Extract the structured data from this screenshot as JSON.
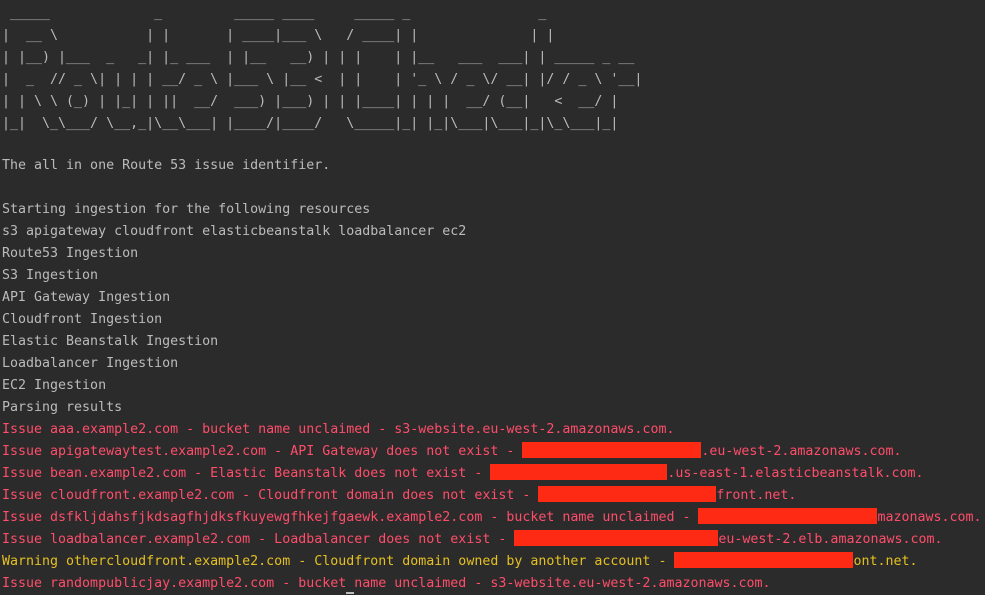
{
  "banner": {
    "ascii_art": " _____             _         _____ ____     _____ _                _\n|  __ \\           | |       | ____|___ \\   / ____| |              | |\n| |__) |___  _   _| |_ ___  | |__   __) | | |    | |__   ___  ___| | _____ _ __\n|  _  // _ \\| | | | __/ _ \\ |___ \\ |__ <  | |    | '_ \\ / _ \\/ __| |/ / _ \\ '__|\n| | \\ \\ (_) | |_| | ||  __/  ___) |___) | | |____| | | |  __/ (__|   <  __/ |\n|_|  \\_\\___/ \\__,_|\\__\\___| |____/|____/   \\_____|_| |_|\\___|\\___|_|\\_\\___|_|"
  },
  "tagline": "The all in one Route 53 issue identifier.",
  "ingestion": {
    "header": "Starting ingestion for the following resources",
    "resources": "s3 apigateway cloudfront elasticbeanstalk loadbalancer ec2",
    "steps": [
      "Route53 Ingestion",
      "S3 Ingestion",
      "API Gateway Ingestion",
      "Cloudfront Ingestion",
      "Elastic Beanstalk Ingestion",
      "Loadbalancer Ingestion",
      "EC2 Ingestion",
      "Parsing results"
    ]
  },
  "results": [
    {
      "text": "Issue aaa.example2.com - bucket name unclaimed - s3-website.eu-west-2.amazonaws.com."
    },
    {
      "prefix": "Issue apigatewaytest.example2.com - API Gateway does not exist - ",
      "suffix": ".eu-west-2.amazonaws.com."
    },
    {
      "prefix": "Issue bean.example2.com - Elastic Beanstalk does not exist - ",
      "suffix": ".us-east-1.elasticbeanstalk.com."
    },
    {
      "prefix": "Issue cloudfront.example2.com - Cloudfront domain does not exist - ",
      "suffix": "front.net."
    },
    {
      "prefix": "Issue dsfkljdahsfjkdsagfhjdksfkuyewgfhkejfgaewk.example2.com - bucket name unclaimed - ",
      "suffix": "mazonaws.com."
    },
    {
      "prefix": "Issue loadbalancer.example2.com - Loadbalancer does not exist - ",
      "suffix": "eu-west-2.elb.amazonaws.com."
    },
    {
      "prefix": "Warning othercloudfront.example2.com - Cloudfront domain owned by another account - ",
      "suffix": "ont.net."
    },
    {
      "text": "Issue randompublicjay.example2.com - bucket name unclaimed - s3-website.eu-west-2.amazonaws.com."
    }
  ],
  "colors": {
    "background": "#2b2b2b",
    "normal_text": "#bbbbbb",
    "issue": "#ff4d6a",
    "warning": "#e5c022",
    "redaction": "#ff2a14"
  }
}
